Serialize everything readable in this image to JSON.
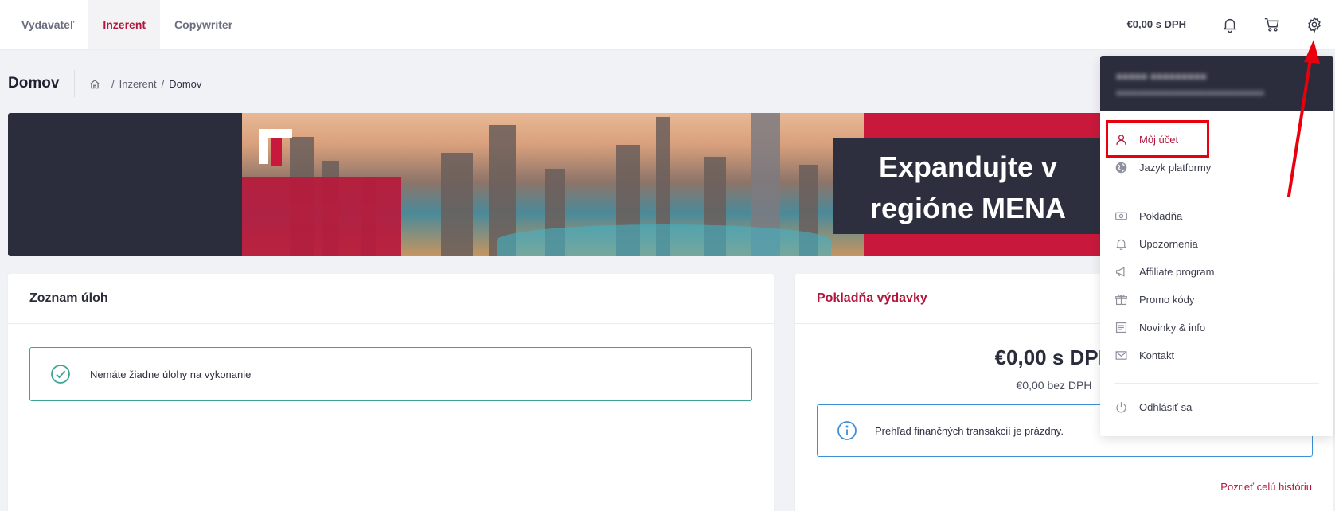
{
  "nav": {
    "tabs": [
      {
        "label": "Vydavateľ",
        "active": false
      },
      {
        "label": "Inzerent",
        "active": true
      },
      {
        "label": "Copywriter",
        "active": false
      }
    ],
    "cart_total": "€0,00 s DPH",
    "icons": [
      "bell-icon",
      "cart-icon",
      "gear-icon"
    ]
  },
  "page": {
    "title": "Domov",
    "breadcrumb": [
      "Inzerent",
      "Domov"
    ],
    "breadcrumb_separator": "/"
  },
  "banner": {
    "headline_line1": "Expandujte v",
    "headline_line2": "regióne MENA"
  },
  "tasks_card": {
    "title": "Zoznam úloh",
    "empty_message": "Nemáte žiadne úlohy na vykonanie"
  },
  "wallet_card": {
    "title": "Pokladňa výdavky",
    "amount_with_vat": "€0,00 s DPH",
    "amount_without_vat": "€0,00 bez DPH",
    "info_message": "Prehľad finančných transakcií je prázdny.",
    "history_link": "Pozrieť celú históriu"
  },
  "user_menu": {
    "items": [
      {
        "label": "Môj účet",
        "icon": "user-icon",
        "active": true
      },
      {
        "label": "Jazyk platformy",
        "icon": "globe-icon",
        "active": false
      },
      {
        "label": "Pokladňa",
        "icon": "money-icon",
        "active": false
      },
      {
        "label": "Upozornenia",
        "icon": "bell-icon",
        "active": false
      },
      {
        "label": "Affiliate program",
        "icon": "megaphone-icon",
        "active": false
      },
      {
        "label": "Promo kódy",
        "icon": "gift-icon",
        "active": false
      },
      {
        "label": "Novinky & info",
        "icon": "newspaper-icon",
        "active": false
      },
      {
        "label": "Kontakt",
        "icon": "envelope-icon",
        "active": false
      },
      {
        "label": "Odhlásiť sa",
        "icon": "power-icon",
        "active": false
      }
    ]
  },
  "colors": {
    "accent": "#b2163b",
    "dark": "#2c2d3c",
    "success": "#3aa394",
    "info": "#3d8fd6",
    "annotation": "#e8000f"
  }
}
